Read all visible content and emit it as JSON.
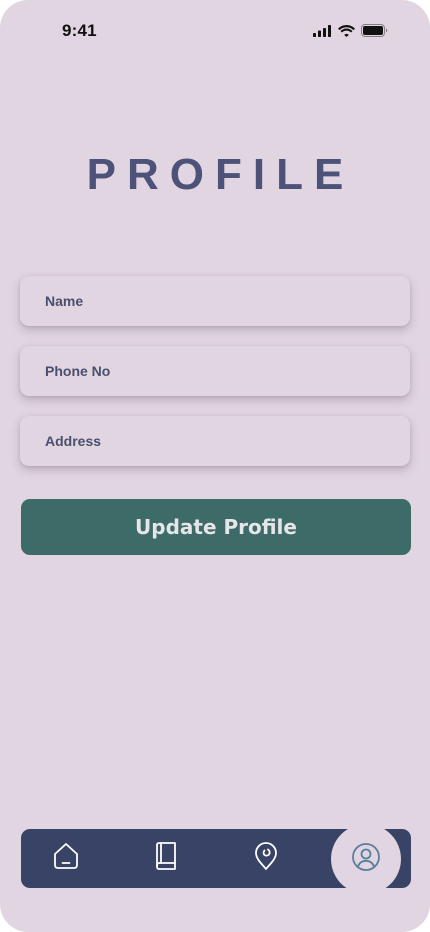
{
  "status_bar": {
    "time": "9:41",
    "icons": [
      "cellular-signal-icon",
      "wifi-icon",
      "battery-icon"
    ]
  },
  "header": {
    "title": "PROFILE"
  },
  "form": {
    "name_placeholder": "Name",
    "phone_placeholder": "Phone No",
    "address_placeholder": "Address",
    "name_value": "",
    "phone_value": "",
    "address_value": ""
  },
  "actions": {
    "update_label": "Update Profile"
  },
  "bottom_nav": {
    "items": [
      {
        "icon": "home-icon",
        "active": false
      },
      {
        "icon": "book-icon",
        "active": false
      },
      {
        "icon": "location-pin-icon",
        "active": false
      },
      {
        "icon": "user-icon",
        "active": true
      }
    ]
  },
  "colors": {
    "background": "#e1d5e1",
    "title": "#4d5378",
    "button": "#3d6b67",
    "nav_bar": "#384366",
    "active_icon": "#5a7f9c"
  }
}
